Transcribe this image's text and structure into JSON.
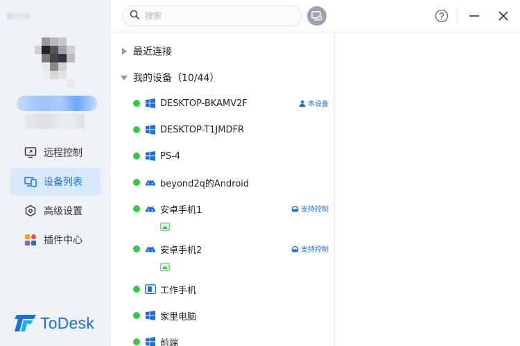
{
  "sidebar": {
    "nav": [
      {
        "label": "远程控制",
        "icon": "remote-control-icon"
      },
      {
        "label": "设备列表",
        "icon": "device-list-icon"
      },
      {
        "label": "高级设置",
        "icon": "settings-icon"
      },
      {
        "label": "插件中心",
        "icon": "plugin-center-icon"
      }
    ],
    "brand": "ToDesk"
  },
  "topbar": {
    "search_placeholder": "搜索"
  },
  "groups": {
    "recent": "最近连接",
    "mine": "我的设备（10/44）"
  },
  "devices": [
    {
      "name": "DESKTOP-BKAMV2F",
      "os": "windows",
      "tag": "本设备"
    },
    {
      "name": "DESKTOP-T1JMDFR",
      "os": "windows"
    },
    {
      "name": "PS-4",
      "os": "windows"
    },
    {
      "name": "beyond2q的Android",
      "os": "android"
    },
    {
      "name": "安卓手机1",
      "os": "android",
      "tag": "支持控制"
    },
    {
      "name": "安卓手机2",
      "os": "android",
      "tag": "支持控制"
    },
    {
      "name": "工作手机",
      "os": "tablet"
    },
    {
      "name": "家里电脑",
      "os": "windows"
    },
    {
      "name": "前端",
      "os": "windows"
    }
  ],
  "colors": {
    "accent": "#1a6fe8",
    "online": "#2ecc40",
    "sidebar_bg": "#eef1f6"
  }
}
